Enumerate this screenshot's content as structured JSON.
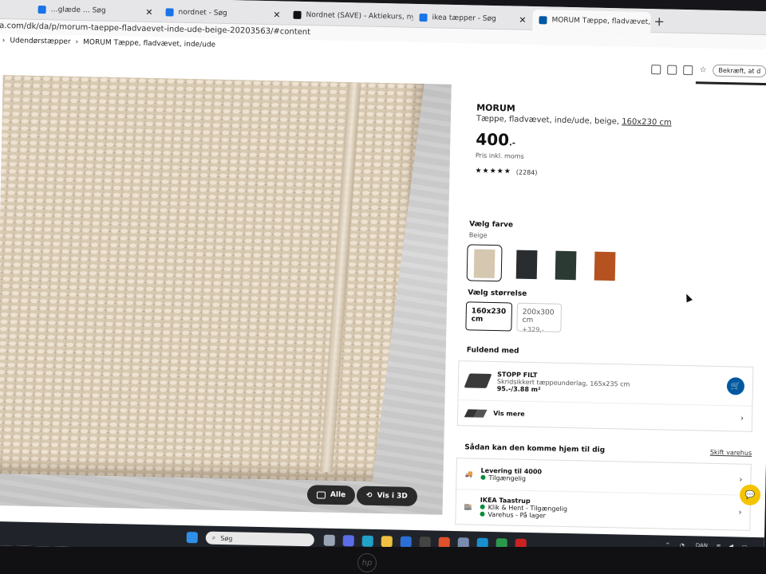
{
  "tabs": [
    {
      "title": "…glæde … Søg",
      "icon": "bing-icon"
    },
    {
      "title": "nordnet - Søg",
      "icon": "bing-icon"
    },
    {
      "title": "Nordnet (SAVE) - Aktiekurs, nyckel",
      "icon": "nordnet-icon"
    },
    {
      "title": "ikea tæpper - Søg",
      "icon": "bing-icon"
    },
    {
      "title": "MORUM Tæppe, fladvævet, inde/…",
      "icon": "ikea-icon",
      "active": true
    }
  ],
  "address": {
    "url": "a.com/dk/da/p/morum-taeppe-fladvaevet-inde-ude-beige-20203563/#content"
  },
  "breadcrumb": {
    "items": [
      "Udendørstæpper",
      "MORUM Tæppe, fladvævet, inde/ude"
    ]
  },
  "toolbar": {
    "pill_label": "Bekræft, at d"
  },
  "product": {
    "name": "MORUM",
    "description": "Tæppe, fladvævet, inde/ude, beige, ",
    "size_link": "160x230 cm",
    "price": "400",
    "price_suffix": ".-",
    "price_note": "Pris inkl. moms",
    "stars": "★★★★★",
    "review_count": "(2284)"
  },
  "photo": {
    "all_label": "Alle",
    "view3d_label": "Vis i 3D"
  },
  "color": {
    "heading": "Vælg farve",
    "selected": "Beige",
    "swatches": [
      "#d5c7b0",
      "#2a2d30",
      "#2c3a34",
      "#b5521f"
    ]
  },
  "size": {
    "heading": "Vælg størrelse",
    "options": [
      {
        "label": "160x230 cm",
        "extra": ""
      },
      {
        "label": "200x300 cm",
        "extra": "+329,-"
      }
    ]
  },
  "complete": {
    "heading": "Fuldend med",
    "item_name": "STOPP FILT",
    "item_desc": "Skridsikkert tæppeunderlag, 165x235 cm",
    "item_price": "95.-/3.88 m²",
    "more_label": "Vis mere"
  },
  "delivery": {
    "heading": "Sådan kan den komme hjem til dig",
    "change_store": "Skift varehus",
    "delivery_label": "Levering til 4000",
    "delivery_status": "Tilgængelig",
    "store_name": "IKEA Taastrup",
    "store_line1": "Klik & Hent - Tilgængelig",
    "store_line2": "Varehus - På lager"
  },
  "taskbar": {
    "search_label": "Søg",
    "lang": "DAN"
  }
}
